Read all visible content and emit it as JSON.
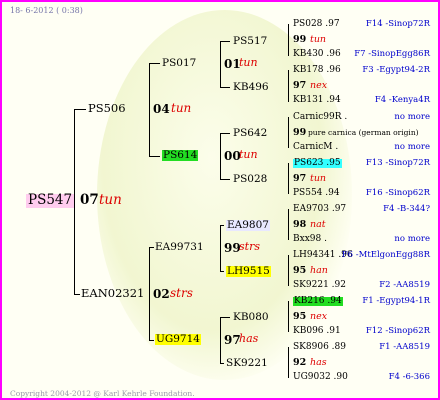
{
  "header": {
    "date": "18- 6-2012 ( 0:38)"
  },
  "footer": {
    "copyright": "Copyright 2004-2012 @ Karl Kehrle Foundation."
  },
  "root": {
    "name": "PS547",
    "year": "07",
    "line": "tun"
  },
  "gen1": {
    "sire": {
      "name": "PS506",
      "year": "04",
      "line": "tun"
    },
    "dam": {
      "name": "EAN02321",
      "year": "02",
      "line": "strs"
    }
  },
  "gen2": {
    "ss": {
      "name": "PS017",
      "year": "01",
      "line": "tun"
    },
    "sd": {
      "name": "PS614",
      "year": "00",
      "line": "tun"
    },
    "ds": {
      "name": "EA99731",
      "year": "99",
      "line": "strs"
    },
    "dd": {
      "name": "UG9714",
      "year": "97",
      "line": "has"
    }
  },
  "gen3": {
    "sss": {
      "name": "PS517"
    },
    "ssd": {
      "name": "KB496"
    },
    "sds": {
      "name": "PS642"
    },
    "sdd": {
      "name": "PS028"
    },
    "dss": {
      "name": "EA9807"
    },
    "dsd": {
      "name": "LH9515"
    },
    "dds": {
      "name": "KB080"
    },
    "ddd": {
      "name": "SK9221"
    }
  },
  "gen4": [
    {
      "top": "PS028 .97",
      "year": "99",
      "line": "tun",
      "bottom": "KB430 .96",
      "top_right": "F14 -Sinop72R",
      "bottom_right": "F7 -SinopEgg86R"
    },
    {
      "top": "KB178 .96",
      "year": "97",
      "line": "nex",
      "bottom": "KB131 .94",
      "top_right": "F3 -Egypt94-2R",
      "bottom_right": "F4 -Kenya4R"
    },
    {
      "top": "Carnic99R .",
      "year": "99",
      "line": "pure carnica (german origin)",
      "bottom": "CarnicM .",
      "top_right": "no more",
      "bottom_right": "no more"
    },
    {
      "top": "PS623 .95",
      "year": "97",
      "line": "tun",
      "bottom": "PS554 .94",
      "top_right": "F13 -Sinop72R",
      "bottom_right": "F16 -Sinop62R"
    },
    {
      "top": "EA9703 .97",
      "year": "98",
      "line": "nat",
      "bottom": "Bxx98 .",
      "top_right": "F4 -B-344?",
      "bottom_right": "no more"
    },
    {
      "top": "LH94341 .96",
      "year": "95",
      "line": "han",
      "bottom": "SK9221 .92",
      "top_right": "F6 -MtElgonEgg88R",
      "bottom_right": "F2 -AA8519"
    },
    {
      "top": "KB216 .94",
      "year": "95",
      "line": "nex",
      "bottom": "KB096 .91",
      "top_right": "F1 -Egypt94-1R",
      "bottom_right": "F12 -Sinop62R"
    },
    {
      "top": "SK8906 .89",
      "year": "92",
      "line": "has",
      "bottom": "UG9032 .90",
      "top_right": "F1 -AA8519",
      "bottom_right": "F4 -6-366"
    }
  ]
}
